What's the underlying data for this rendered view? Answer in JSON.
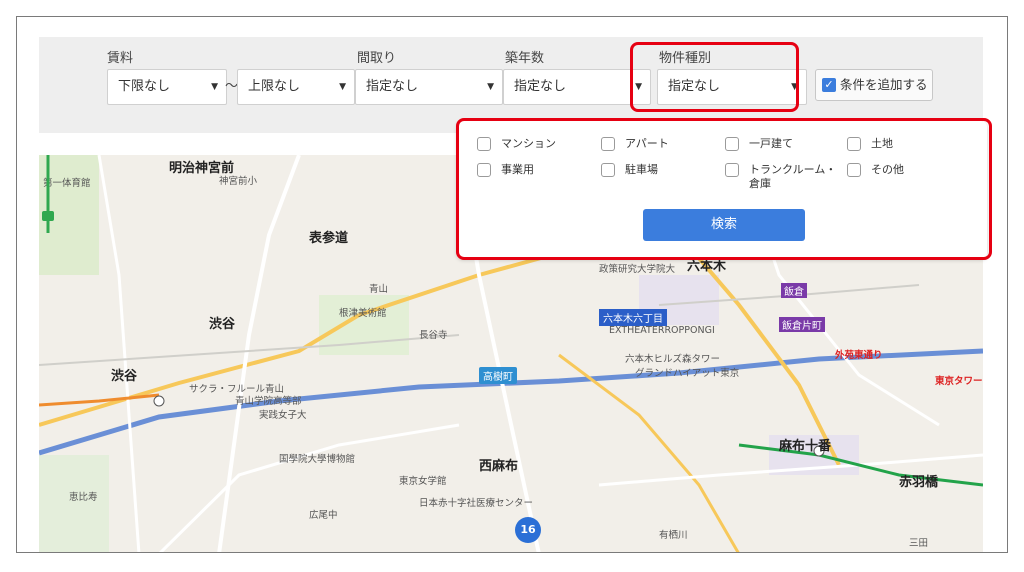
{
  "filters": {
    "rent": {
      "label": "賃料",
      "min_value": "下限なし",
      "separator": "〜",
      "max_value": "上限なし"
    },
    "layout": {
      "label": "間取り",
      "value": "指定なし"
    },
    "age": {
      "label": "築年数",
      "value": "指定なし"
    },
    "type": {
      "label": "物件種別",
      "value": "指定なし"
    },
    "add_button": "条件を追加する"
  },
  "property_types": [
    {
      "label": "マンション",
      "checked": false
    },
    {
      "label": "アパート",
      "checked": false
    },
    {
      "label": "一戸建て",
      "checked": false
    },
    {
      "label": "土地",
      "checked": false
    },
    {
      "label": "事業用",
      "checked": false
    },
    {
      "label": "駐車場",
      "checked": false
    },
    {
      "label": "トランクルーム・倉庫",
      "checked": false
    },
    {
      "label": "その他",
      "checked": false
    }
  ],
  "search_button": "検索",
  "map": {
    "labels": {
      "meiji": "明治神宮前",
      "jingu": "神宮前小",
      "omotesando": "表参道",
      "shibuya": "渋谷",
      "roppongi": "六本木",
      "roppongi_7": "六本木六丁目",
      "ex": "EXTHEATERROPPONGI",
      "azabujuban": "麻布十番",
      "akabanebashi": "赤羽橋",
      "nishiazabu": "西麻布",
      "aoyama": "青山",
      "takagicho": "高樹町",
      "iikura": "飯倉",
      "iikura_katamachi": "飯倉片町",
      "gaien": "外苑東通り",
      "tokyo_tower": "東京タワー",
      "hiroo": "広尾中",
      "sendagaya": "第一体育館",
      "nezu": "根津美術館",
      "chojuji": "長谷寺",
      "mitsui": "三田",
      "jitsujo": "実践女子大",
      "kokugakuin": "国學院大學博物館",
      "ebisu": "恵比寿",
      "sakura": "サクラ・フルール青山",
      "aoyama_gakuin": "青山学院高等部",
      "tokyo_joshi": "東京女学館",
      "nisseki": "日本赤十字社医療センター",
      "arisugawa": "有栖川",
      "grand_hyatt": "グランドハイアット東京",
      "hills": "六本木ヒルズ森タワー",
      "seisaku": "政策研究大学院大",
      "shibuya_st": "渋谷"
    },
    "cluster_count": "16"
  },
  "colors": {
    "accent": "#3b7ddd",
    "highlight": "#e60012",
    "panel": "#eeeeee"
  }
}
